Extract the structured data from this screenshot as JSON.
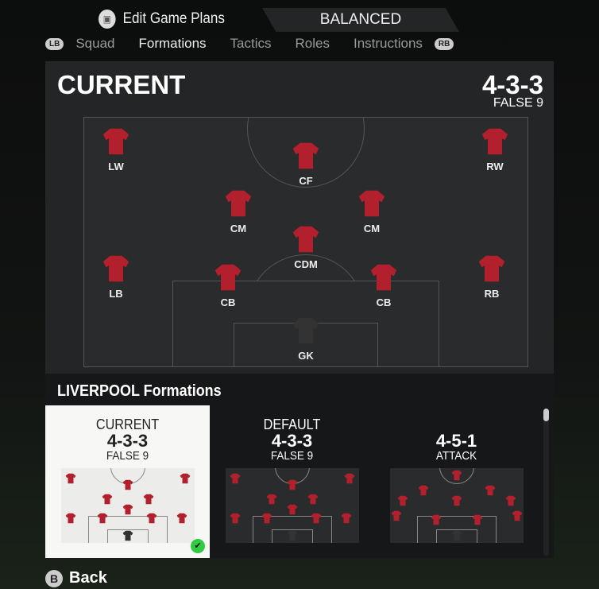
{
  "header": {
    "title": "Edit Game Plans",
    "game_plan": "BALANCED"
  },
  "tabs": {
    "lb": "LB",
    "rb": "RB",
    "items": [
      "Squad",
      "Formations",
      "Tactics",
      "Roles",
      "Instructions"
    ],
    "active": "Formations"
  },
  "current": {
    "title": "CURRENT",
    "formation": "4-3-3",
    "variant": "FALSE 9",
    "players": [
      "LW",
      "CF",
      "RW",
      "CM",
      "CM",
      "CDM",
      "LB",
      "CB",
      "CB",
      "RB",
      "GK"
    ]
  },
  "formations": {
    "title": "LIVERPOOL Formations",
    "cards": [
      {
        "label": "CURRENT",
        "formation": "4-3-3",
        "variant": "FALSE 9",
        "selected": true
      },
      {
        "label": "DEFAULT",
        "formation": "4-3-3",
        "variant": "FALSE 9",
        "selected": false
      },
      {
        "label": "",
        "formation": "4-5-1",
        "variant": "ATTACK",
        "selected": false
      }
    ]
  },
  "footer": {
    "back_button": "B",
    "back_label": "Back"
  },
  "colors": {
    "shirt": "#b3202d",
    "check": "#2ecc40"
  }
}
